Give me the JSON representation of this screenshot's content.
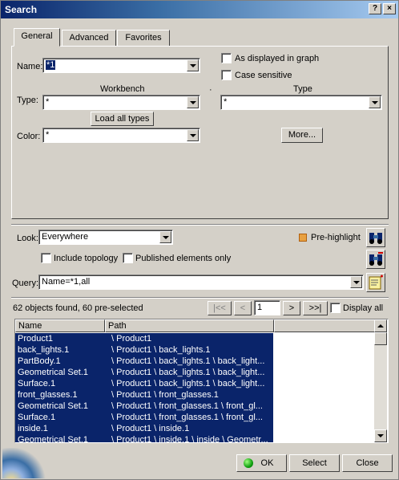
{
  "window": {
    "title": "Search",
    "help_label": "?",
    "close_label": "×"
  },
  "tabs": [
    {
      "label": "General"
    },
    {
      "label": "Advanced"
    },
    {
      "label": "Favorites"
    }
  ],
  "general": {
    "name_label": "Name:",
    "name_value": "*1",
    "workbench_header": "Workbench",
    "type_header": "Type",
    "type_label": "Type:",
    "workbench_value": "*",
    "type_value": "*",
    "load_all_types": "Load all types",
    "color_label": "Color:",
    "color_value": "*",
    "more_button": "More...",
    "as_displayed": "As displayed in graph",
    "case_sensitive": "Case sensitive"
  },
  "look": {
    "label": "Look:",
    "value": "Everywhere",
    "prehighlight": "Pre-highlight"
  },
  "options": {
    "include_topology": "Include topology",
    "published_only": "Published elements only"
  },
  "query": {
    "label": "Query:",
    "value": "Name=*1,all"
  },
  "results": {
    "summary": "62 objects found, 60 pre-selected",
    "first": "|<<",
    "prev": "<",
    "page": "1",
    "next": ">",
    "last": ">>|",
    "display_all": "Display all",
    "columns": [
      "Name",
      "Path"
    ],
    "rows": [
      {
        "name": "Product1",
        "path": "\\ Product1"
      },
      {
        "name": "back_lights.1",
        "path": "\\ Product1 \\ back_lights.1"
      },
      {
        "name": "PartBody.1",
        "path": "\\ Product1 \\ back_lights.1 \\ back_light..."
      },
      {
        "name": "Geometrical Set.1",
        "path": "\\ Product1 \\ back_lights.1 \\ back_light..."
      },
      {
        "name": "Surface.1",
        "path": "\\ Product1 \\ back_lights.1 \\ back_light..."
      },
      {
        "name": "front_glasses.1",
        "path": "\\ Product1 \\ front_glasses.1"
      },
      {
        "name": "Geometrical Set.1",
        "path": "\\ Product1 \\ front_glasses.1 \\ front_gl..."
      },
      {
        "name": "Surface.1",
        "path": "\\ Product1 \\ front_glasses.1 \\ front_gl..."
      },
      {
        "name": "inside.1",
        "path": "\\ Product1 \\ inside.1"
      },
      {
        "name": "Geometrical Set.1",
        "path": "\\ Product1 \\ inside.1 \\ inside \\ Geometr..."
      }
    ]
  },
  "footer": {
    "ok": "OK",
    "select": "Select",
    "close": "Close"
  },
  "colors": {
    "selection": "#0a246a",
    "titlebar": "#0a246a",
    "face": "#d4d0c8",
    "prehighlight": "#e8a040"
  }
}
